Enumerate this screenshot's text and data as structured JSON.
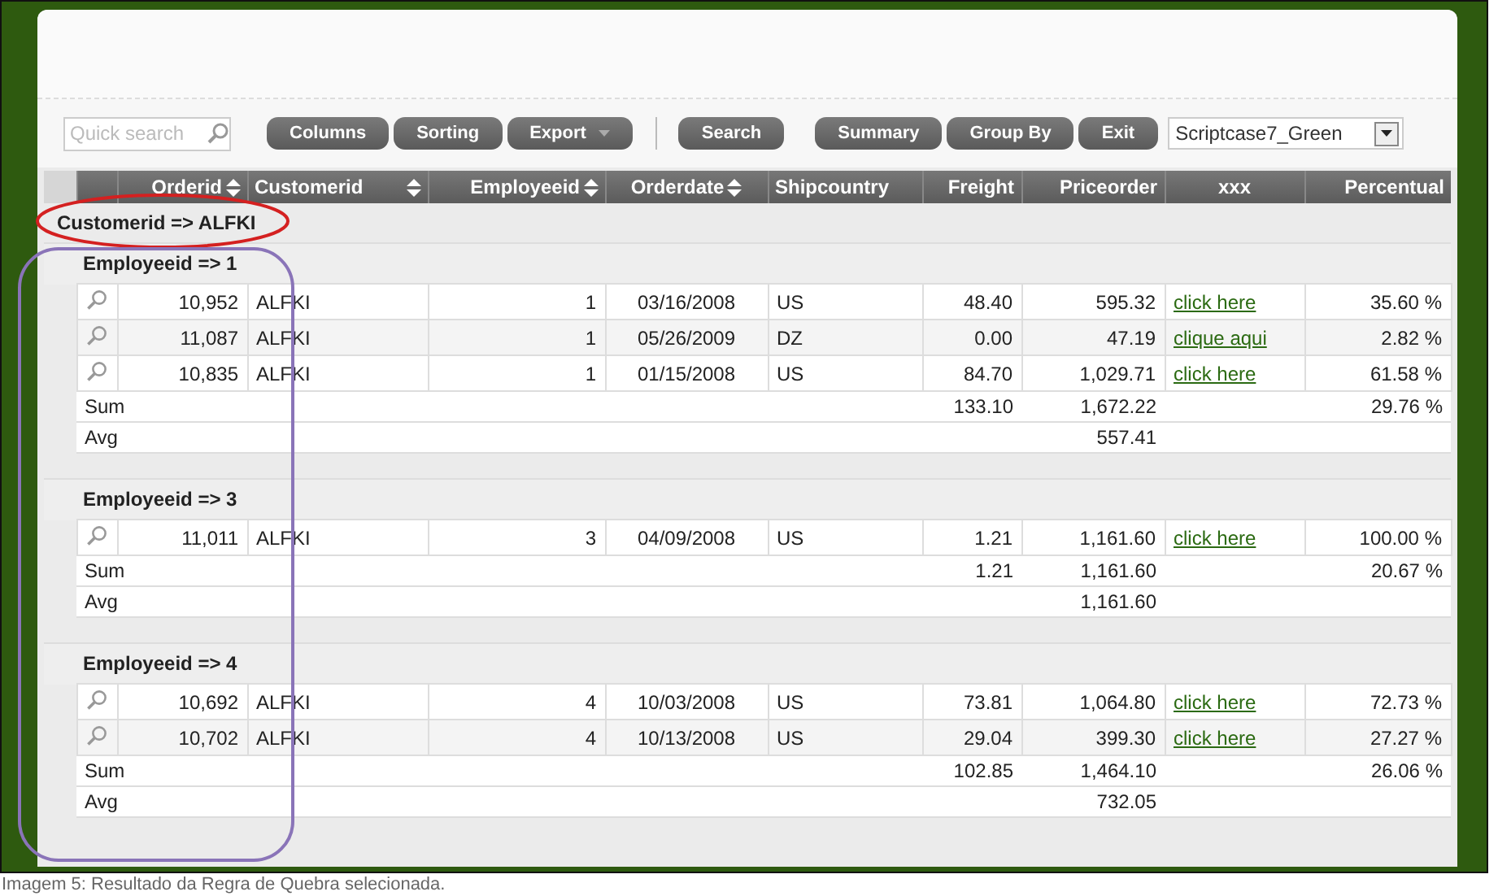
{
  "toolbar": {
    "quick_search": {
      "placeholder": "Quick search"
    },
    "buttons": [
      {
        "label": "Columns",
        "kind": "button"
      },
      {
        "label": "Sorting",
        "kind": "button"
      },
      {
        "label": "Export",
        "kind": "menu"
      },
      {
        "kind": "separator"
      },
      {
        "label": "Search",
        "kind": "button"
      },
      {
        "kind": "gap"
      },
      {
        "label": "Summary",
        "kind": "button"
      },
      {
        "label": "Group By",
        "kind": "button"
      },
      {
        "label": "Exit",
        "kind": "button"
      }
    ],
    "theme_select": {
      "value": "Scriptcase7_Green"
    }
  },
  "table": {
    "columns": [
      {
        "label": "Orderid",
        "kind": "number",
        "sortable": true
      },
      {
        "label": "Customerid",
        "kind": "text",
        "sortable": true
      },
      {
        "label": "Employeeid",
        "kind": "number",
        "sortable": true
      },
      {
        "label": "Orderdate",
        "kind": "date",
        "sortable": true
      },
      {
        "label": "Shipcountry",
        "kind": "text",
        "sortable": false
      },
      {
        "label": "Freight",
        "kind": "number",
        "sortable": false
      },
      {
        "label": "Priceorder",
        "kind": "number",
        "sortable": false
      },
      {
        "label": "xxx",
        "kind": "link",
        "sortable": false
      },
      {
        "label": "Percentual",
        "kind": "number",
        "sortable": false
      }
    ],
    "group": {
      "label": "Customerid => ALFKI",
      "subgroups": [
        {
          "label": "Employeeid => 1",
          "rows": [
            [
              "10,952",
              "ALFKI",
              "1",
              "03/16/2008",
              "US",
              "48.40",
              "595.32",
              "click here",
              "35.60 %"
            ],
            [
              "11,087",
              "ALFKI",
              "1",
              "05/26/2009",
              "DZ",
              "0.00",
              "47.19",
              "clique aqui",
              "2.82 %"
            ],
            [
              "10,835",
              "ALFKI",
              "1",
              "01/15/2008",
              "US",
              "84.70",
              "1,029.71",
              "click here",
              "61.58 %"
            ]
          ],
          "sum": {
            "label": "Sum",
            "freight": "133.10",
            "priceorder": "1,672.22",
            "percentual": "29.76 %"
          },
          "avg": {
            "label": "Avg",
            "priceorder": "557.41"
          }
        },
        {
          "label": "Employeeid => 3",
          "rows": [
            [
              "11,011",
              "ALFKI",
              "3",
              "04/09/2008",
              "US",
              "1.21",
              "1,161.60",
              "click here",
              "100.00 %"
            ]
          ],
          "sum": {
            "label": "Sum",
            "freight": "1.21",
            "priceorder": "1,161.60",
            "percentual": "20.67 %"
          },
          "avg": {
            "label": "Avg",
            "priceorder": "1,161.60"
          }
        },
        {
          "label": "Employeeid => 4",
          "rows": [
            [
              "10,692",
              "ALFKI",
              "4",
              "10/03/2008",
              "US",
              "73.81",
              "1,064.80",
              "click here",
              "72.73 %"
            ],
            [
              "10,702",
              "ALFKI",
              "4",
              "10/13/2008",
              "US",
              "29.04",
              "399.30",
              "click here",
              "27.27 %"
            ]
          ],
          "sum": {
            "label": "Sum",
            "freight": "102.85",
            "priceorder": "1,464.10",
            "percentual": "26.06 %"
          },
          "avg": {
            "label": "Avg",
            "priceorder": "732.05"
          }
        }
      ]
    }
  },
  "caption": "Imagem 5: Resultado da Regra de Quebra selecionada."
}
